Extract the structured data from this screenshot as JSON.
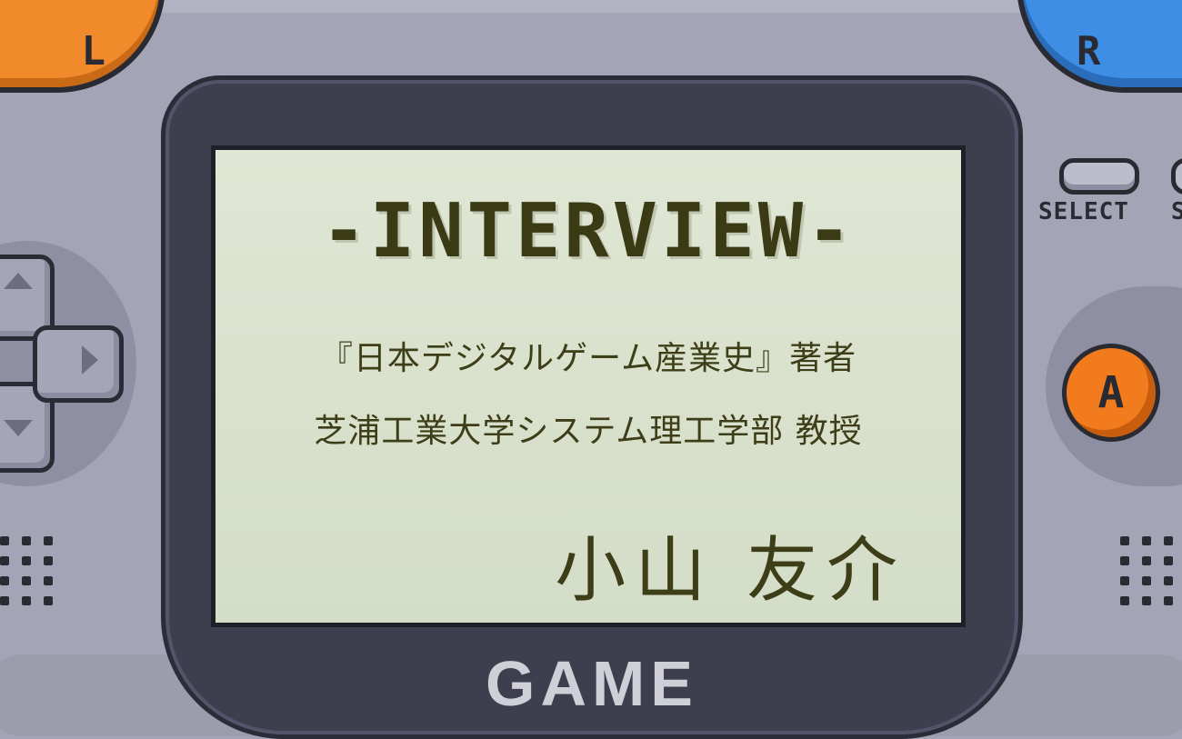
{
  "screen": {
    "title": "-INTERVIEW-",
    "book_line": "『日本デジタルゲーム産業史』著者",
    "affiliation_line": "芝浦工業大学システム理工学部 教授",
    "name": "小山 友介"
  },
  "console": {
    "bezel_label": "GAME",
    "select_label": "SELECT",
    "start_label": "S",
    "a_button_label": "A",
    "shoulder_left_label": "L",
    "shoulder_right_label": "R",
    "colors": {
      "body": "#a4a4b6",
      "bezel": "#3f3e4f",
      "screen": "#dfe6d3",
      "screen_text": "#3a3a14",
      "a_button": "#f27b1d",
      "shoulder_left": "#f08a2a",
      "shoulder_right": "#3f8ee6",
      "background": "#c98be0"
    }
  }
}
